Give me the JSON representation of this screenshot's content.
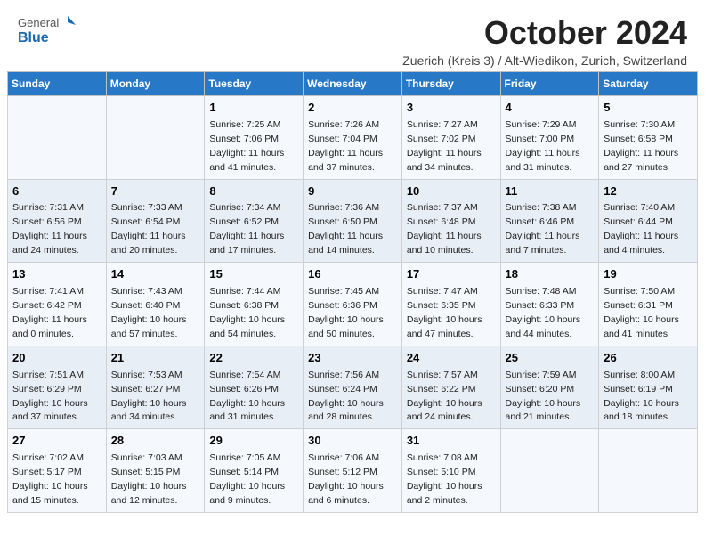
{
  "header": {
    "logo_general": "General",
    "logo_blue": "Blue",
    "title": "October 2024",
    "subtitle": "Zuerich (Kreis 3) / Alt-Wiedikon, Zurich, Switzerland"
  },
  "weekdays": [
    "Sunday",
    "Monday",
    "Tuesday",
    "Wednesday",
    "Thursday",
    "Friday",
    "Saturday"
  ],
  "weeks": [
    [
      {
        "day": "",
        "info": ""
      },
      {
        "day": "",
        "info": ""
      },
      {
        "day": "1",
        "info": "Sunrise: 7:25 AM\nSunset: 7:06 PM\nDaylight: 11 hours and 41 minutes."
      },
      {
        "day": "2",
        "info": "Sunrise: 7:26 AM\nSunset: 7:04 PM\nDaylight: 11 hours and 37 minutes."
      },
      {
        "day": "3",
        "info": "Sunrise: 7:27 AM\nSunset: 7:02 PM\nDaylight: 11 hours and 34 minutes."
      },
      {
        "day": "4",
        "info": "Sunrise: 7:29 AM\nSunset: 7:00 PM\nDaylight: 11 hours and 31 minutes."
      },
      {
        "day": "5",
        "info": "Sunrise: 7:30 AM\nSunset: 6:58 PM\nDaylight: 11 hours and 27 minutes."
      }
    ],
    [
      {
        "day": "6",
        "info": "Sunrise: 7:31 AM\nSunset: 6:56 PM\nDaylight: 11 hours and 24 minutes."
      },
      {
        "day": "7",
        "info": "Sunrise: 7:33 AM\nSunset: 6:54 PM\nDaylight: 11 hours and 20 minutes."
      },
      {
        "day": "8",
        "info": "Sunrise: 7:34 AM\nSunset: 6:52 PM\nDaylight: 11 hours and 17 minutes."
      },
      {
        "day": "9",
        "info": "Sunrise: 7:36 AM\nSunset: 6:50 PM\nDaylight: 11 hours and 14 minutes."
      },
      {
        "day": "10",
        "info": "Sunrise: 7:37 AM\nSunset: 6:48 PM\nDaylight: 11 hours and 10 minutes."
      },
      {
        "day": "11",
        "info": "Sunrise: 7:38 AM\nSunset: 6:46 PM\nDaylight: 11 hours and 7 minutes."
      },
      {
        "day": "12",
        "info": "Sunrise: 7:40 AM\nSunset: 6:44 PM\nDaylight: 11 hours and 4 minutes."
      }
    ],
    [
      {
        "day": "13",
        "info": "Sunrise: 7:41 AM\nSunset: 6:42 PM\nDaylight: 11 hours and 0 minutes."
      },
      {
        "day": "14",
        "info": "Sunrise: 7:43 AM\nSunset: 6:40 PM\nDaylight: 10 hours and 57 minutes."
      },
      {
        "day": "15",
        "info": "Sunrise: 7:44 AM\nSunset: 6:38 PM\nDaylight: 10 hours and 54 minutes."
      },
      {
        "day": "16",
        "info": "Sunrise: 7:45 AM\nSunset: 6:36 PM\nDaylight: 10 hours and 50 minutes."
      },
      {
        "day": "17",
        "info": "Sunrise: 7:47 AM\nSunset: 6:35 PM\nDaylight: 10 hours and 47 minutes."
      },
      {
        "day": "18",
        "info": "Sunrise: 7:48 AM\nSunset: 6:33 PM\nDaylight: 10 hours and 44 minutes."
      },
      {
        "day": "19",
        "info": "Sunrise: 7:50 AM\nSunset: 6:31 PM\nDaylight: 10 hours and 41 minutes."
      }
    ],
    [
      {
        "day": "20",
        "info": "Sunrise: 7:51 AM\nSunset: 6:29 PM\nDaylight: 10 hours and 37 minutes."
      },
      {
        "day": "21",
        "info": "Sunrise: 7:53 AM\nSunset: 6:27 PM\nDaylight: 10 hours and 34 minutes."
      },
      {
        "day": "22",
        "info": "Sunrise: 7:54 AM\nSunset: 6:26 PM\nDaylight: 10 hours and 31 minutes."
      },
      {
        "day": "23",
        "info": "Sunrise: 7:56 AM\nSunset: 6:24 PM\nDaylight: 10 hours and 28 minutes."
      },
      {
        "day": "24",
        "info": "Sunrise: 7:57 AM\nSunset: 6:22 PM\nDaylight: 10 hours and 24 minutes."
      },
      {
        "day": "25",
        "info": "Sunrise: 7:59 AM\nSunset: 6:20 PM\nDaylight: 10 hours and 21 minutes."
      },
      {
        "day": "26",
        "info": "Sunrise: 8:00 AM\nSunset: 6:19 PM\nDaylight: 10 hours and 18 minutes."
      }
    ],
    [
      {
        "day": "27",
        "info": "Sunrise: 7:02 AM\nSunset: 5:17 PM\nDaylight: 10 hours and 15 minutes."
      },
      {
        "day": "28",
        "info": "Sunrise: 7:03 AM\nSunset: 5:15 PM\nDaylight: 10 hours and 12 minutes."
      },
      {
        "day": "29",
        "info": "Sunrise: 7:05 AM\nSunset: 5:14 PM\nDaylight: 10 hours and 9 minutes."
      },
      {
        "day": "30",
        "info": "Sunrise: 7:06 AM\nSunset: 5:12 PM\nDaylight: 10 hours and 6 minutes."
      },
      {
        "day": "31",
        "info": "Sunrise: 7:08 AM\nSunset: 5:10 PM\nDaylight: 10 hours and 2 minutes."
      },
      {
        "day": "",
        "info": ""
      },
      {
        "day": "",
        "info": ""
      }
    ]
  ]
}
